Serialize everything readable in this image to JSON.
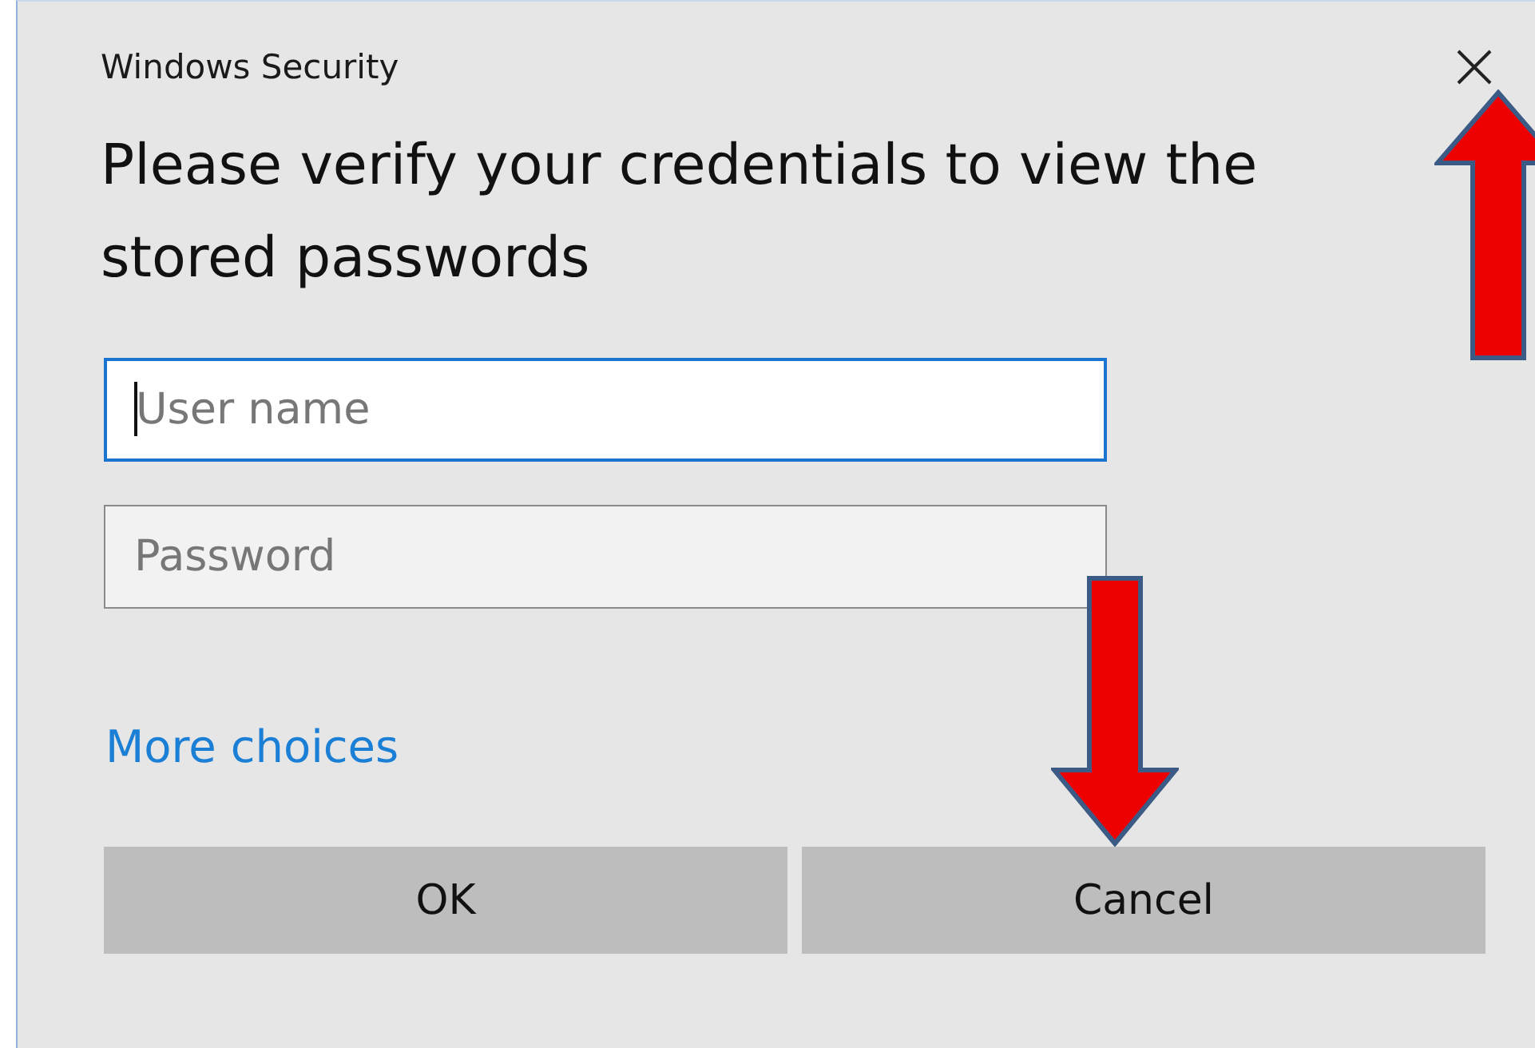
{
  "window": {
    "title": "Windows Security"
  },
  "heading": "Please verify your credentials to view the stored passwords",
  "fields": [
    {
      "placeholder": "User name",
      "focused": true
    },
    {
      "placeholder": "Password",
      "focused": false
    }
  ],
  "link": "More choices",
  "buttons": [
    "OK",
    "Cancel"
  ],
  "annotations": [
    {
      "kind": "up"
    },
    {
      "kind": "down"
    }
  ]
}
